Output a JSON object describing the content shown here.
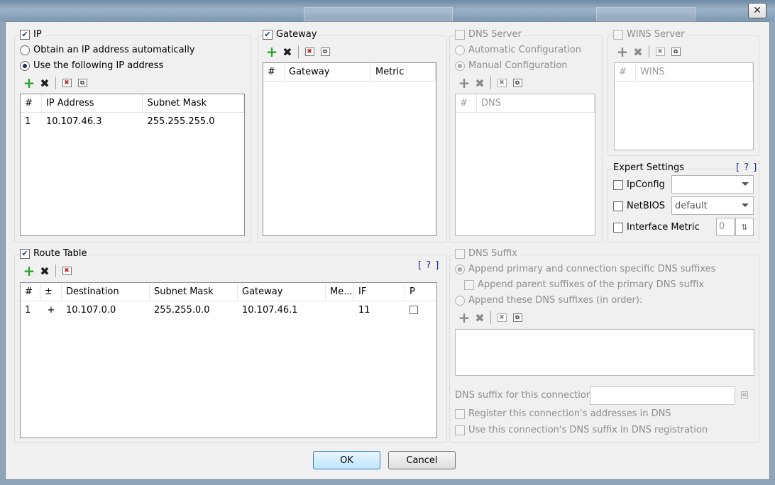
{
  "window": {
    "close_glyph": "✕"
  },
  "ip": {
    "title": "IP",
    "enabled": true,
    "opt_auto": "Obtain an IP address automatically",
    "opt_manual": "Use the following IP address",
    "selected": "manual",
    "columns": [
      "#",
      "IP Address",
      "Subnet Mask"
    ],
    "rows": [
      [
        "1",
        "10.107.46.3",
        "255.255.255.0"
      ]
    ]
  },
  "gateway": {
    "title": "Gateway",
    "enabled": true,
    "columns": [
      "#",
      "Gateway",
      "Metric"
    ],
    "rows": []
  },
  "dns_server": {
    "title": "DNS Server",
    "enabled": false,
    "opt_auto": "Automatic Configuration",
    "opt_manual": "Manual Configuration",
    "selected": "manual",
    "columns": [
      "#",
      "DNS"
    ],
    "rows": []
  },
  "wins_server": {
    "title": "WINS Server",
    "enabled": false,
    "columns": [
      "#",
      "WINS"
    ],
    "rows": []
  },
  "expert": {
    "title": "Expert Settings",
    "help": "[ ? ]",
    "ipconfig_label": "IpConfig",
    "ipconfig_value": "",
    "netbios_label": "NetBIOS",
    "netbios_value": "default",
    "metric_label": "Interface Metric",
    "metric_value": "0"
  },
  "route_table": {
    "title": "Route Table",
    "enabled": true,
    "help": "[ ? ]",
    "columns": [
      "#",
      "±",
      "Destination",
      "Subnet Mask",
      "Gateway",
      "Me...",
      "IF",
      "P"
    ],
    "rows": [
      [
        "1",
        "+",
        "10.107.0.0",
        "255.255.0.0",
        "10.107.46.1",
        "",
        "11",
        ""
      ]
    ]
  },
  "dns_suffix": {
    "title": "DNS Suffix",
    "enabled": false,
    "opt_primary": "Append primary and connection specific DNS suffixes",
    "opt_parent": "Append parent suffixes of the primary DNS suffix",
    "opt_these": "Append these DNS suffixes (in order):",
    "connection_label": "DNS suffix for this connection:",
    "connection_value": "",
    "register_label": "Register this connection's addresses in DNS",
    "use_suffix_label": "Use this connection's DNS suffix in DNS registration"
  },
  "buttons": {
    "ok": "OK",
    "cancel": "Cancel"
  },
  "icons": {
    "add": "plus-icon",
    "delete": "x-icon",
    "clear": "clear-list-icon",
    "copy": "copy-icon"
  },
  "colors": {
    "accent": "#2fa22f",
    "help": "#1b2f8f",
    "default_button": "#bee6fd"
  }
}
